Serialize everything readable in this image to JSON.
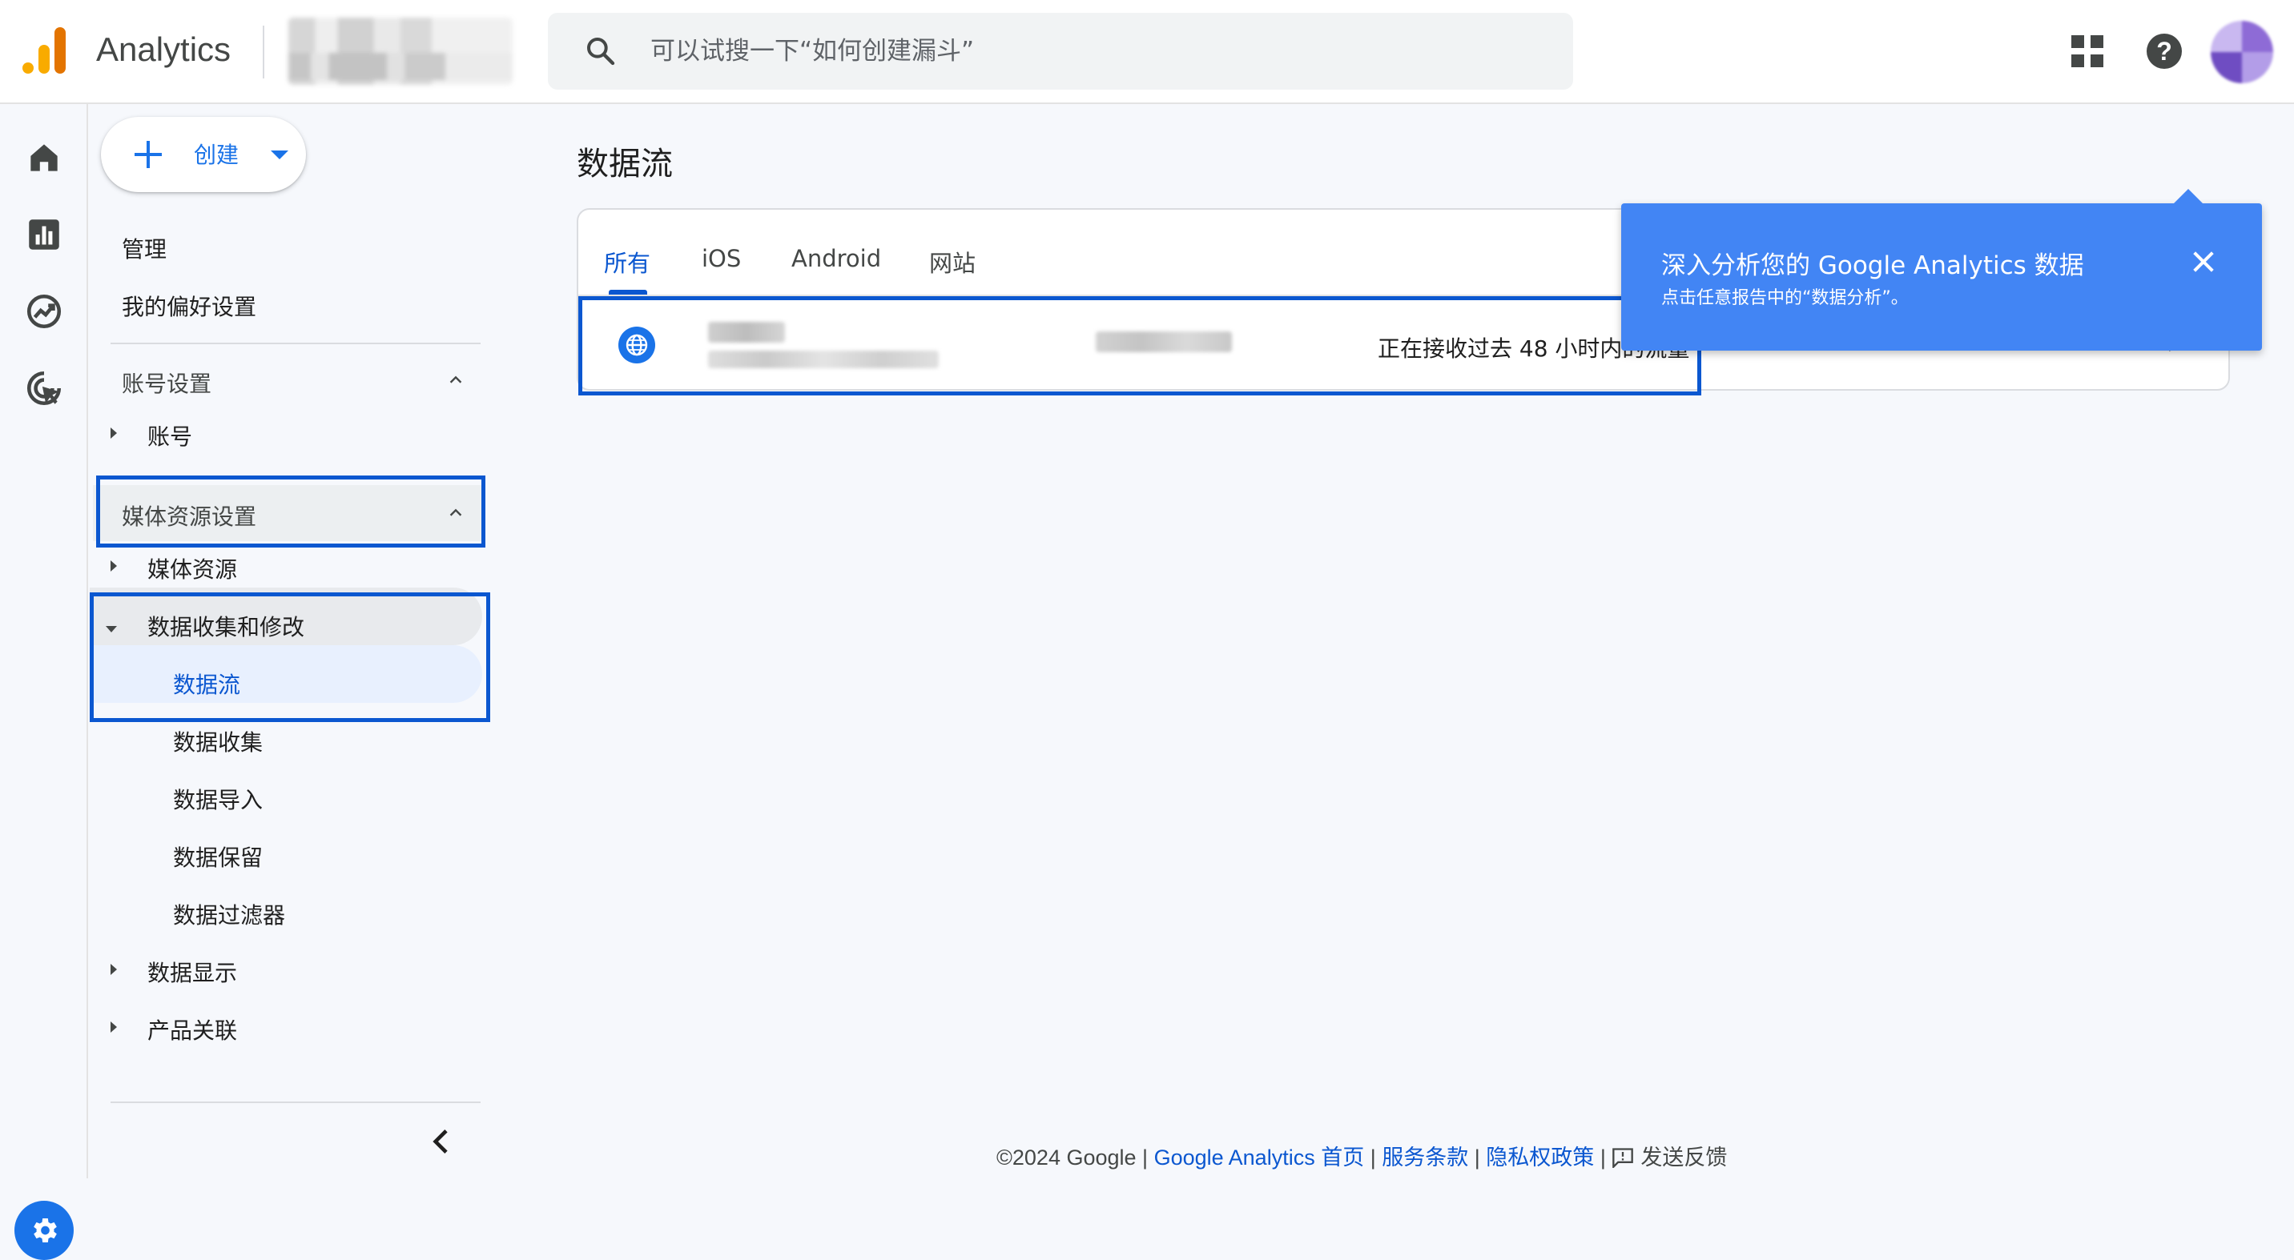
{
  "app": {
    "title": "Analytics"
  },
  "search": {
    "placeholder": "可以试搜一下“如何创建漏斗”"
  },
  "colors": {
    "accent": "#1a73e8",
    "active_text": "#0b57d0",
    "tooltip_bg": "#4285f4",
    "logo_light": "#f9ab00",
    "logo_dark": "#e37400"
  },
  "rail": {
    "icons": [
      "home-icon",
      "reports-icon",
      "explore-icon",
      "advertising-icon"
    ],
    "settings_icon": "gear-icon"
  },
  "nav": {
    "create_label": "创建",
    "admin": "管理",
    "preferences": "我的偏好设置",
    "account_settings": {
      "title": "账号设置",
      "items": [
        "账号"
      ]
    },
    "property_settings": {
      "title": "媒体资源设置",
      "items": {
        "property": "媒体资源",
        "data_collection_modification": {
          "label": "数据收集和修改",
          "children": [
            "数据流",
            "数据收集",
            "数据导入",
            "数据保留",
            "数据过滤器"
          ],
          "active_child": "数据流"
        },
        "data_display": "数据显示",
        "product_links": "产品关联"
      }
    }
  },
  "main": {
    "page_title": "数据流",
    "tabs": [
      "所有",
      "iOS",
      "Android",
      "网站"
    ],
    "active_tab": "所有",
    "stream_row": {
      "icon": "globe-icon",
      "status": "正在接收过去 48 小时内的流量"
    }
  },
  "tooltip": {
    "title": "深入分析您的 Google Analytics 数据",
    "subtitle": "点击任意报告中的“数据分析”。",
    "close_icon": "close-icon"
  },
  "footer": {
    "copyright": "©2024 Google",
    "sep": "|",
    "home_link": "Google Analytics 首页",
    "terms_link": "服务条款",
    "privacy_link": "隐私权政策",
    "feedback": "发送反馈"
  }
}
